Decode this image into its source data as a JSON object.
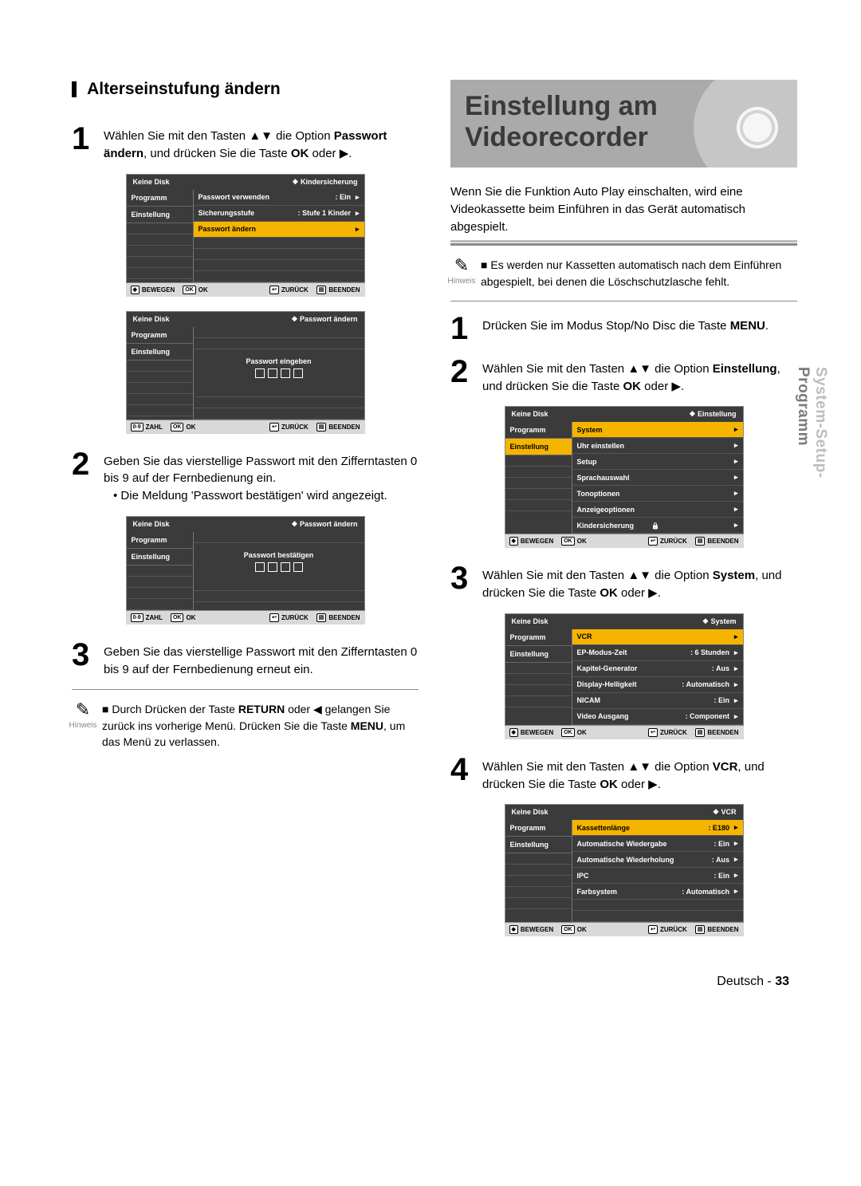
{
  "side_tab": {
    "line1": "System-Setup-",
    "line2": "Programm"
  },
  "left": {
    "heading": "Alterseinstufung ändern",
    "step1": "Wählen Sie mit den Tasten ▲▼ die Option Passwort ändern, und drücken Sie die Taste OK oder ▶.",
    "step2": "Geben Sie das vierstellige Passwort mit den Zifferntasten 0 bis 9 auf der Fernbedienung ein.",
    "step2_bullet": "Die Meldung 'Passwort bestätigen' wird angezeigt.",
    "step3": "Geben Sie das vierstellige Passwort mit den Zifferntasten 0 bis 9 auf der Fernbedienung erneut ein.",
    "note": "Durch Drücken der Taste RETURN oder ◀ gelangen Sie zurück ins vorherige Menü. Drücken Sie die Taste MENU, um das Menü zu verlassen.",
    "note_label": "Hinweis"
  },
  "right": {
    "heading_l1": "Einstellung am",
    "heading_l2": "Videorecorder",
    "intro": "Wenn Sie die Funktion Auto Play einschalten, wird eine Videokassette beim Einführen in das Gerät automatisch abgespielt.",
    "note": "Es werden nur Kassetten automatisch nach dem Einführen abgespielt, bei denen die Löschschutzlasche fehlt.",
    "note_label": "Hinweis",
    "step1": "Drücken Sie im Modus Stop/No Disc die Taste MENU.",
    "step2": "Wählen Sie mit den Tasten ▲▼ die Option Einstellung, und drücken Sie die Taste OK oder ▶.",
    "step3": "Wählen Sie mit den Tasten ▲▼ die Option System, und drücken Sie die Taste OK oder ▶.",
    "step4": "Wählen Sie mit den Tasten ▲▼ die Option VCR, und drücken Sie die Taste OK oder ▶."
  },
  "osd_common": {
    "no_disk": "Keine Disk",
    "left_items": [
      "Programm",
      "Einstellung"
    ],
    "foot_bewegen": "BEWEGEN",
    "foot_zahl": "ZAHL",
    "foot_ok": "OK",
    "foot_zurueck": "ZURÜCK",
    "foot_beenden": "BEENDEN"
  },
  "osd1": {
    "title_r": "Kindersicherung",
    "rows": [
      {
        "lab": "Passwort verwenden",
        "val": ": Ein"
      },
      {
        "lab": "Sicherungsstufe",
        "val": ": Stufe 1 Kinder"
      },
      {
        "lab": "Passwort ändern",
        "val": ""
      }
    ]
  },
  "osd2": {
    "title_r": "Passwort ändern",
    "center": "Passwort eingeben"
  },
  "osd3": {
    "title_r": "Passwort ändern",
    "center": "Passwort bestätigen"
  },
  "osd4": {
    "title_r": "Einstellung",
    "rows": [
      {
        "lab": "System",
        "val": ""
      },
      {
        "lab": "Uhr einstellen",
        "val": ""
      },
      {
        "lab": "Setup",
        "val": ""
      },
      {
        "lab": "Sprachauswahl",
        "val": ""
      },
      {
        "lab": "Tonoptionen",
        "val": ""
      },
      {
        "lab": "Anzeigeoptionen",
        "val": ""
      },
      {
        "lab": "Kindersicherung",
        "val": ""
      }
    ]
  },
  "osd5": {
    "title_r": "System",
    "rows": [
      {
        "lab": "VCR",
        "val": ""
      },
      {
        "lab": "EP-Modus-Zeit",
        "val": ": 6 Stunden"
      },
      {
        "lab": "Kapitel-Generator",
        "val": ": Aus"
      },
      {
        "lab": "Display-Helligkeit",
        "val": ": Automatisch"
      },
      {
        "lab": "NICAM",
        "val": ": Ein"
      },
      {
        "lab": "Video Ausgang",
        "val": ": Component"
      }
    ]
  },
  "osd6": {
    "title_r": "VCR",
    "rows": [
      {
        "lab": "Kassettenlänge",
        "val": ": E180"
      },
      {
        "lab": "Automatische Wiedergabe",
        "val": ": Ein"
      },
      {
        "lab": "Automatische Wiederholung",
        "val": ": Aus"
      },
      {
        "lab": "IPC",
        "val": ": Ein"
      },
      {
        "lab": "Farbsystem",
        "val": ": Automatisch"
      }
    ]
  },
  "footer": {
    "lang": "Deutsch",
    "page": "33"
  }
}
